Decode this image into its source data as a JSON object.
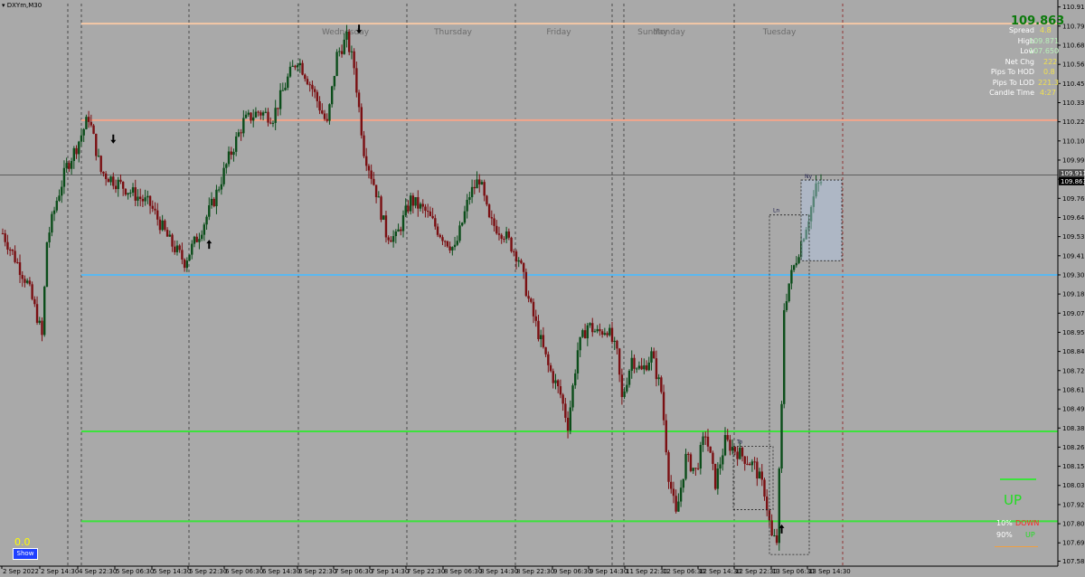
{
  "window": {
    "symbol": "DXYm,M30"
  },
  "colors": {
    "background": "#a9a9a9",
    "bull": "#0b4d1a",
    "bear": "#7a0f12",
    "line_peach": "#f5c8a6",
    "line_salmon": "#f4a58a",
    "line_blue": "#5bb8f0",
    "line_green": "#3ce23c",
    "current_line": "#555555"
  },
  "day_labels": [
    "Wednesday",
    "Thursday",
    "Friday",
    "Sunday",
    "Monday",
    "Tuesday"
  ],
  "info_panel": {
    "price": "109.863",
    "rows": [
      {
        "label": "Spread",
        "value": "4.8"
      },
      {
        "label": "High",
        "value": "109.871"
      },
      {
        "label": "Low",
        "value": "107.650"
      },
      {
        "label": "Net Chg",
        "value": "222"
      },
      {
        "label": "Pips To HOD",
        "value": "0.8"
      },
      {
        "label": "Pips To LOD",
        "value": "221.3"
      },
      {
        "label": "Candle Time",
        "value": "4:27"
      }
    ]
  },
  "strength_panel": {
    "trend_label": "UP",
    "down_pct": "10%",
    "down_label": "DOWN",
    "up_pct": "90%",
    "up_label": "UP"
  },
  "bottom_left": {
    "value": "0.0",
    "button": "Show"
  },
  "box_labels": {
    "ny": "Ny",
    "ln": "Ln",
    "to": "To"
  },
  "current_price_tags": [
    "109.911",
    "109.863"
  ],
  "chart_data": {
    "type": "candlestick",
    "ylim": [
      107.55,
      110.93
    ],
    "y_ticks": [
      "110.910",
      "110.795",
      "110.680",
      "110.565",
      "110.450",
      "110.335",
      "110.220",
      "110.105",
      "109.990",
      "109.875",
      "109.760",
      "109.645",
      "109.530",
      "109.415",
      "109.300",
      "109.185",
      "109.070",
      "108.955",
      "108.840",
      "108.725",
      "108.610",
      "108.495",
      "108.380",
      "108.265",
      "108.150",
      "108.035",
      "107.920",
      "107.805",
      "107.690",
      "107.580"
    ],
    "x_ticks": [
      "2 Sep 2022",
      "2 Sep 14:30",
      "4 Sep 22:30",
      "5 Sep 06:30",
      "5 Sep 14:30",
      "5 Sep 22:30",
      "6 Sep 06:30",
      "6 Sep 14:30",
      "6 Sep 22:30",
      "7 Sep 06:30",
      "7 Sep 14:30",
      "7 Sep 22:30",
      "8 Sep 06:30",
      "8 Sep 14:30",
      "8 Sep 22:30",
      "9 Sep 06:30",
      "9 Sep 14:30",
      "11 Sep 22:30",
      "12 Sep 06:30",
      "12 Sep 14:30",
      "12 Sep 22:30",
      "13 Sep 06:30",
      "13 Sep 14:30"
    ],
    "horizontal_levels": [
      {
        "value": 110.81,
        "color": "#f5c8a6"
      },
      {
        "value": 110.23,
        "color": "#f4a58a"
      },
      {
        "value": 109.3,
        "color": "#5bb8f0"
      },
      {
        "value": 108.36,
        "color": "#3ce23c"
      },
      {
        "value": 107.82,
        "color": "#3ce23c"
      }
    ],
    "current_price": 109.9,
    "anchors": [
      [
        0,
        109.55
      ],
      [
        10,
        109.25
      ],
      [
        14,
        109.05
      ],
      [
        16,
        108.93
      ],
      [
        18,
        109.5
      ],
      [
        22,
        109.75
      ],
      [
        26,
        109.95
      ],
      [
        30,
        110.07
      ],
      [
        35,
        110.25
      ],
      [
        40,
        109.92
      ],
      [
        50,
        109.82
      ],
      [
        60,
        109.72
      ],
      [
        68,
        109.5
      ],
      [
        74,
        109.38
      ],
      [
        80,
        109.55
      ],
      [
        86,
        109.75
      ],
      [
        92,
        110.0
      ],
      [
        98,
        110.22
      ],
      [
        104,
        110.28
      ],
      [
        110,
        110.25
      ],
      [
        116,
        110.48
      ],
      [
        120,
        110.6
      ],
      [
        126,
        110.42
      ],
      [
        132,
        110.2
      ],
      [
        136,
        110.62
      ],
      [
        140,
        110.72
      ],
      [
        143,
        110.55
      ],
      [
        147,
        110.05
      ],
      [
        152,
        109.8
      ],
      [
        156,
        109.55
      ],
      [
        160,
        109.52
      ],
      [
        166,
        109.75
      ],
      [
        172,
        109.68
      ],
      [
        178,
        109.55
      ],
      [
        184,
        109.45
      ],
      [
        190,
        109.78
      ],
      [
        194,
        109.88
      ],
      [
        198,
        109.62
      ],
      [
        204,
        109.55
      ],
      [
        210,
        109.4
      ],
      [
        214,
        109.15
      ],
      [
        218,
        108.95
      ],
      [
        222,
        108.75
      ],
      [
        227,
        108.58
      ],
      [
        230,
        108.4
      ],
      [
        234,
        108.85
      ],
      [
        238,
        109.0
      ],
      [
        242,
        108.95
      ],
      [
        246,
        108.98
      ],
      [
        250,
        108.82
      ],
      [
        252,
        108.55
      ],
      [
        256,
        108.8
      ],
      [
        260,
        108.72
      ],
      [
        264,
        108.82
      ],
      [
        268,
        108.6
      ],
      [
        271,
        108.1
      ],
      [
        274,
        107.85
      ],
      [
        278,
        108.2
      ],
      [
        282,
        108.12
      ],
      [
        286,
        108.35
      ],
      [
        290,
        108.05
      ],
      [
        294,
        108.3
      ],
      [
        298,
        108.25
      ],
      [
        302,
        108.2
      ],
      [
        306,
        108.15
      ],
      [
        310,
        108.0
      ],
      [
        313,
        107.72
      ],
      [
        315,
        107.7
      ],
      [
        317,
        108.5
      ],
      [
        318,
        109.1
      ],
      [
        320,
        109.25
      ],
      [
        324,
        109.45
      ],
      [
        328,
        109.65
      ],
      [
        331,
        109.82
      ],
      [
        333,
        109.86
      ]
    ],
    "extras": {
      "arrows_down": [
        [
          45,
          110.1
        ],
        [
          145,
          110.76
        ]
      ],
      "arrows_up": [
        [
          84,
          109.5
        ],
        [
          317,
          107.79
        ]
      ]
    }
  }
}
